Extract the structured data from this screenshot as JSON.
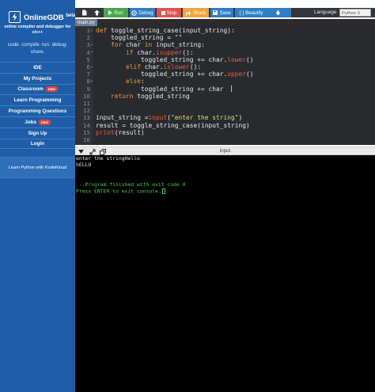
{
  "sidebar": {
    "brand_name": "OnlineGDB",
    "brand_beta": "beta",
    "tagline": "online compiler and debugger for c/c++",
    "motto": "code. compile. run. debug. share.",
    "items": [
      {
        "label": "IDE"
      },
      {
        "label": "My Projects"
      },
      {
        "label": "Classroom",
        "badge": "new"
      },
      {
        "label": "Learn Programming"
      },
      {
        "label": "Programming Questions"
      },
      {
        "label": "Jobs",
        "badge": "new"
      },
      {
        "label": "Sign Up"
      },
      {
        "label": "Login"
      }
    ],
    "promo": "Learn Python with KodeKloud"
  },
  "toolbar": {
    "run": "Run",
    "debug": "Debug",
    "stop": "Stop",
    "share": "Share",
    "save": "Save",
    "beautify": "{ } Beautify",
    "language_label": "Language",
    "language_value": "Python 3"
  },
  "editor": {
    "file_tab": "main.py",
    "line_numbers": [
      "1",
      "2",
      "3",
      "4",
      "5",
      "6",
      "7",
      "8",
      "9",
      "10",
      "11",
      "12",
      "13",
      "14",
      "15",
      "16"
    ]
  },
  "console": {
    "title": "input",
    "lines": [
      "enter the stringHello",
      "hELLO",
      "",
      "",
      "...Program finished with exit code 0",
      "Press ENTER to exit console."
    ]
  },
  "colors": {
    "sidebar_bg": "#1e5ea8",
    "run": "#4aa64a",
    "debug": "#2f7fc4",
    "stop": "#e0534d",
    "share": "#f0a53a",
    "save": "#2f7fc4",
    "beautify": "#2f7fc4",
    "download": "#2f7fc4"
  }
}
